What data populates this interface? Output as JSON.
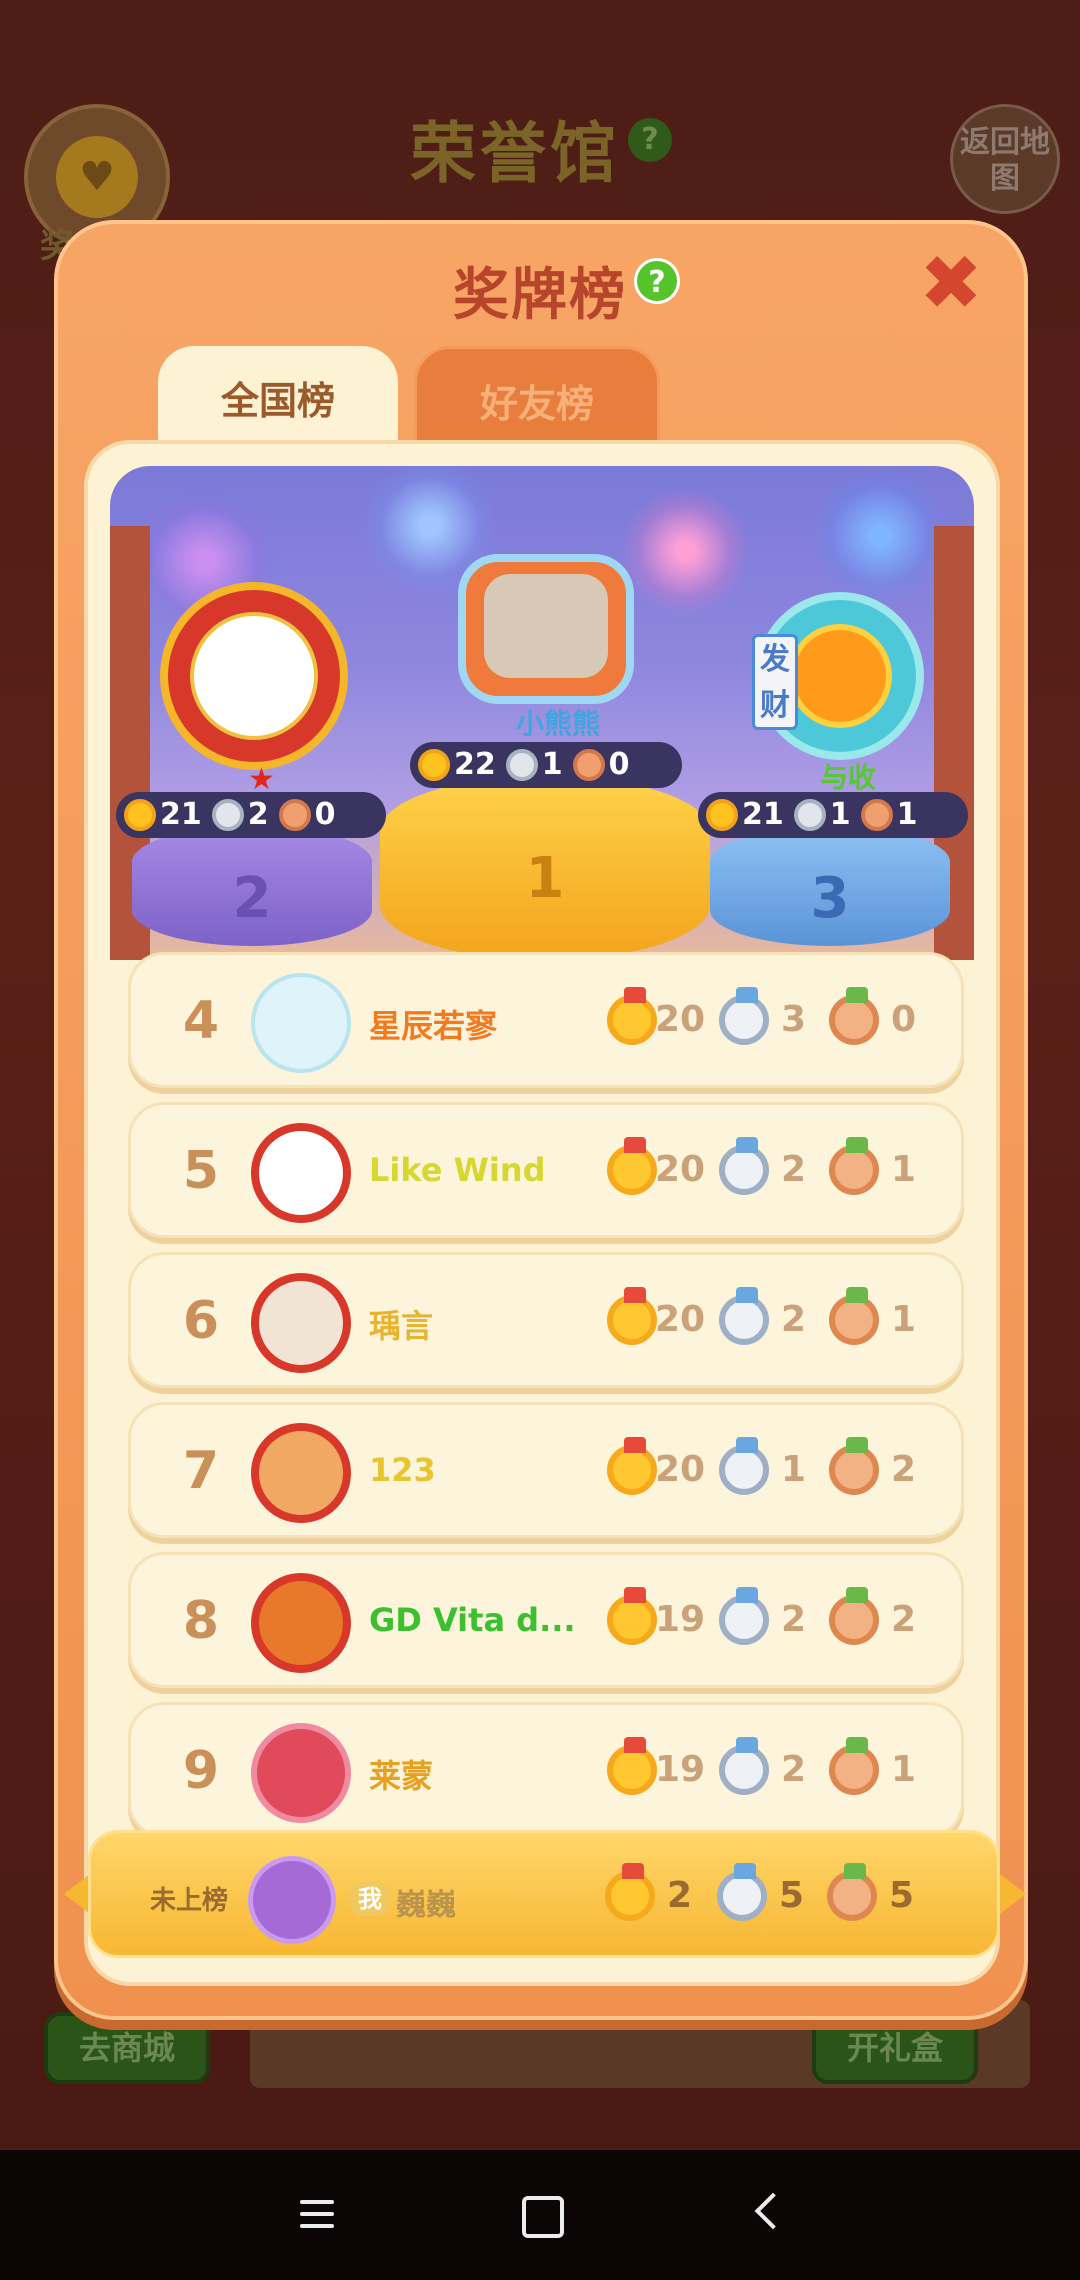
{
  "background": {
    "title": "荣誉馆",
    "help_symbol": "?",
    "return_button": "返回地图",
    "badge_label": "奖",
    "shop_button": "去商城",
    "gift_button": "开礼盒"
  },
  "modal": {
    "title": "奖牌榜",
    "help_symbol": "?",
    "close_symbol": "✖",
    "tabs": [
      {
        "label": "全国榜",
        "active": true
      },
      {
        "label": "好友榜",
        "active": false
      }
    ]
  },
  "podium": [
    {
      "place": "1",
      "name": "小熊熊",
      "gold": "22",
      "silver": "1",
      "bronze": "0",
      "name_color": "#3fa6e0"
    },
    {
      "place": "2",
      "name": "",
      "gold": "21",
      "silver": "2",
      "bronze": "0",
      "name_color": "#e23b2a"
    },
    {
      "place": "3",
      "name": "与收",
      "gold": "21",
      "silver": "1",
      "bronze": "1",
      "name_color": "#55c832"
    }
  ],
  "rows": [
    {
      "rank": "4",
      "name": "星辰若寥",
      "gold": "20",
      "silver": "3",
      "bronze": "0",
      "name_color": "#f47a20"
    },
    {
      "rank": "5",
      "name": "Like  Wind",
      "gold": "20",
      "silver": "2",
      "bronze": "1",
      "name_color": "#d8d630"
    },
    {
      "rank": "6",
      "name": "瑀言",
      "gold": "20",
      "silver": "2",
      "bronze": "1",
      "name_color": "#e8b430"
    },
    {
      "rank": "7",
      "name": "123",
      "gold": "20",
      "silver": "1",
      "bronze": "2",
      "name_color": "#e8c430"
    },
    {
      "rank": "8",
      "name": "GD Vita d...",
      "gold": "19",
      "silver": "2",
      "bronze": "2",
      "name_color": "#3cc030"
    },
    {
      "rank": "9",
      "name": "莱蒙",
      "gold": "19",
      "silver": "2",
      "bronze": "1",
      "name_color": "#e8a020"
    }
  ],
  "me": {
    "status": "未上榜",
    "badge": "我",
    "name": "巍巍",
    "gold": "2",
    "silver": "5",
    "bronze": "5"
  },
  "colors": {
    "accent": "#f09150",
    "panel": "#fdf2d4",
    "gold_medal": "#ffc830",
    "silver_medal": "#eef1f6",
    "bronze_medal": "#f3b284"
  }
}
